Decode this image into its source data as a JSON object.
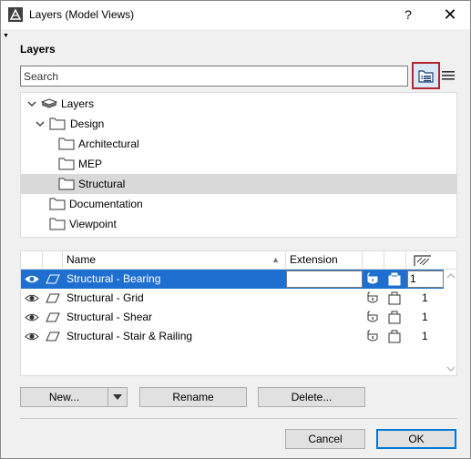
{
  "window": {
    "title": "Layers (Model Views)",
    "help_label": "?",
    "close_label": "✕"
  },
  "section": {
    "title": "Layers"
  },
  "search": {
    "placeholder": "Search"
  },
  "tree": {
    "items": [
      {
        "label": "Layers",
        "icon": "layers-stack-icon",
        "expanded": true
      },
      {
        "label": "Design",
        "icon": "folder-icon",
        "expanded": true
      },
      {
        "label": "Architectural",
        "icon": "folder-icon"
      },
      {
        "label": "MEP",
        "icon": "folder-icon"
      },
      {
        "label": "Structural",
        "icon": "folder-icon",
        "selected": true
      },
      {
        "label": "Documentation",
        "icon": "folder-icon"
      },
      {
        "label": "Viewpoint",
        "icon": "folder-icon"
      }
    ]
  },
  "table": {
    "columns": {
      "name": "Name",
      "extension": "Extension"
    },
    "rows": [
      {
        "name": "Structural - Bearing",
        "number": "1",
        "selected": true
      },
      {
        "name": "Structural - Grid",
        "number": "1"
      },
      {
        "name": "Structural - Shear",
        "number": "1"
      },
      {
        "name": "Structural - Stair & Railing",
        "number": "1"
      }
    ]
  },
  "buttons": {
    "new": "New...",
    "rename": "Rename",
    "delete": "Delete...",
    "cancel": "Cancel",
    "ok": "OK"
  },
  "colors": {
    "selection": "#1f6fd0",
    "highlight_border": "#b3262f",
    "tree_selection": "#d9d9d9"
  }
}
